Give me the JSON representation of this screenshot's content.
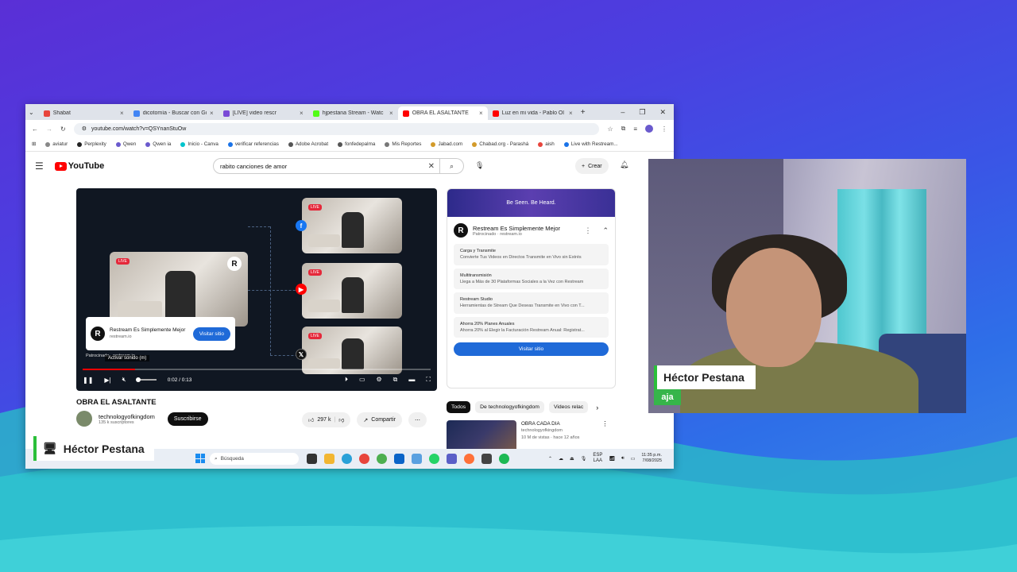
{
  "browser": {
    "tabs": [
      {
        "label": "Shabat",
        "active": false,
        "color": "#e8453c"
      },
      {
        "label": "dicotomía - Buscar con Go",
        "active": false,
        "color": "#4285f4"
      },
      {
        "label": "[LIVE] video rescr",
        "active": false,
        "color": "#7a4ad6"
      },
      {
        "label": "hjpestana Stream - Watc",
        "active": false,
        "color": "#53fc18"
      },
      {
        "label": "OBRA EL ASALTANTE",
        "active": true,
        "color": "#ff0000"
      },
      {
        "label": "Luz en mi vida - Pablo Ol",
        "active": false,
        "color": "#ff0000"
      }
    ],
    "url": "youtube.com/watch?v=QSYnanStuOw",
    "bookmarks": [
      "aviatur",
      "Perplexity",
      "Qwen",
      "Qwen ia",
      "Inicio - Canva",
      "verificar referencias",
      "Adobe Acrobat",
      "fonfedepalma",
      "Mis Reportes",
      "Jabad.com",
      "Chabad.org - Parashá",
      "aish",
      "Live with Restream..."
    ]
  },
  "youtube": {
    "logo": "YouTube",
    "search_value": "rabito canciones de amor",
    "create_label": "Crear"
  },
  "video": {
    "ad_title": "Restream Es Simplemente Mejor",
    "ad_domain": "restream.io",
    "visit_label": "Visitar sitio",
    "sponsored_label": "Patrocinado · restream.io",
    "mute_tooltip": "Activar sonido (m)",
    "time": "0:02 / 0:13",
    "progress_fraction": 0.15,
    "live_label": "LIVE"
  },
  "meta": {
    "title": "OBRA EL ASALTANTE",
    "channel": "technologyofkingdom",
    "subscribers": "135 k suscriptores",
    "subscribe_label": "Suscribirse",
    "likes": "297 k",
    "share_label": "Compartir"
  },
  "sidebar_ad": {
    "banner": "Be Seen. Be Heard.",
    "title": "Restream Es Simplemente Mejor",
    "sponsor": "Patrocinado · restream.io",
    "features": [
      {
        "title": "Carga y Transmite",
        "desc": "Convierte Tus Videos en Directos Transmite en Vivo sin Estrés"
      },
      {
        "title": "Multitransmisión",
        "desc": "Llega a Más de 30 Plataformas Sociales a la Vez con Restream"
      },
      {
        "title": "Restream Studio",
        "desc": "Herramientas de Stream Que Deseas Transmite en Vivo con T..."
      },
      {
        "title": "Ahorra 20% Planes Anuales",
        "desc": "Ahorra 20% al Elegir la Facturación Restream Anual: Registrat..."
      }
    ],
    "visit_label": "Visitar sitio"
  },
  "chips": [
    "Todos",
    "De technologyofkingdom",
    "Videos relac"
  ],
  "recommended": {
    "title": "OBRA CADA DIA",
    "channel": "technologyofkingdom",
    "stats": "10 M de vistas · hace 12 años"
  },
  "taskbar": {
    "search_placeholder": "Búsqueda",
    "lang": "ESP",
    "lang2": "LAA",
    "time": "11:35 p.m.",
    "date": "7/08/2025"
  },
  "overlay": {
    "screen_name": "Héctor Pestana",
    "cam_name": "Héctor Pestana",
    "cam_caption": "aja"
  },
  "colors": {
    "accent_green": "#2bbf3a",
    "youtube_red": "#ff0000",
    "link_blue": "#1f6ad8"
  }
}
